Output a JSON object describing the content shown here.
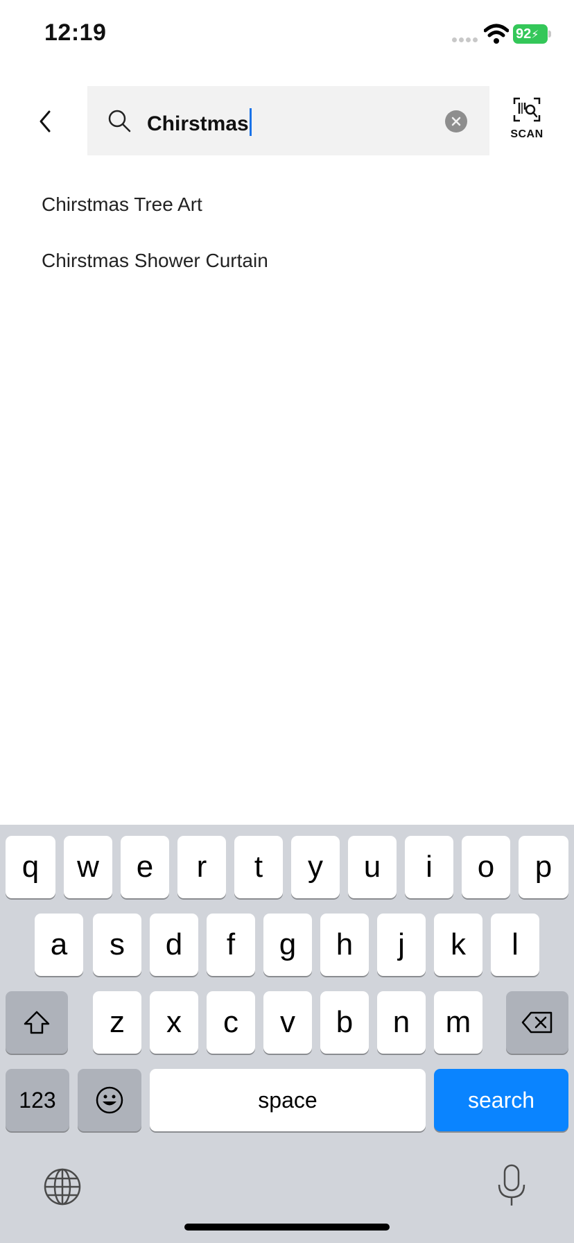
{
  "status_bar": {
    "time": "12:19",
    "battery": "92"
  },
  "search": {
    "query": "Chirstmas",
    "scan_label": "SCAN"
  },
  "suggestions": [
    "Chirstmas Tree Art",
    "Chirstmas Shower Curtain"
  ],
  "keyboard": {
    "row1": [
      "q",
      "w",
      "e",
      "r",
      "t",
      "y",
      "u",
      "i",
      "o",
      "p"
    ],
    "row2": [
      "a",
      "s",
      "d",
      "f",
      "g",
      "h",
      "j",
      "k",
      "l"
    ],
    "row3": [
      "z",
      "x",
      "c",
      "v",
      "b",
      "n",
      "m"
    ],
    "numbers_label": "123",
    "space_label": "space",
    "search_label": "search"
  },
  "colors": {
    "accent": "#0a84ff",
    "battery": "#34c759",
    "caret": "#1a73e8"
  }
}
